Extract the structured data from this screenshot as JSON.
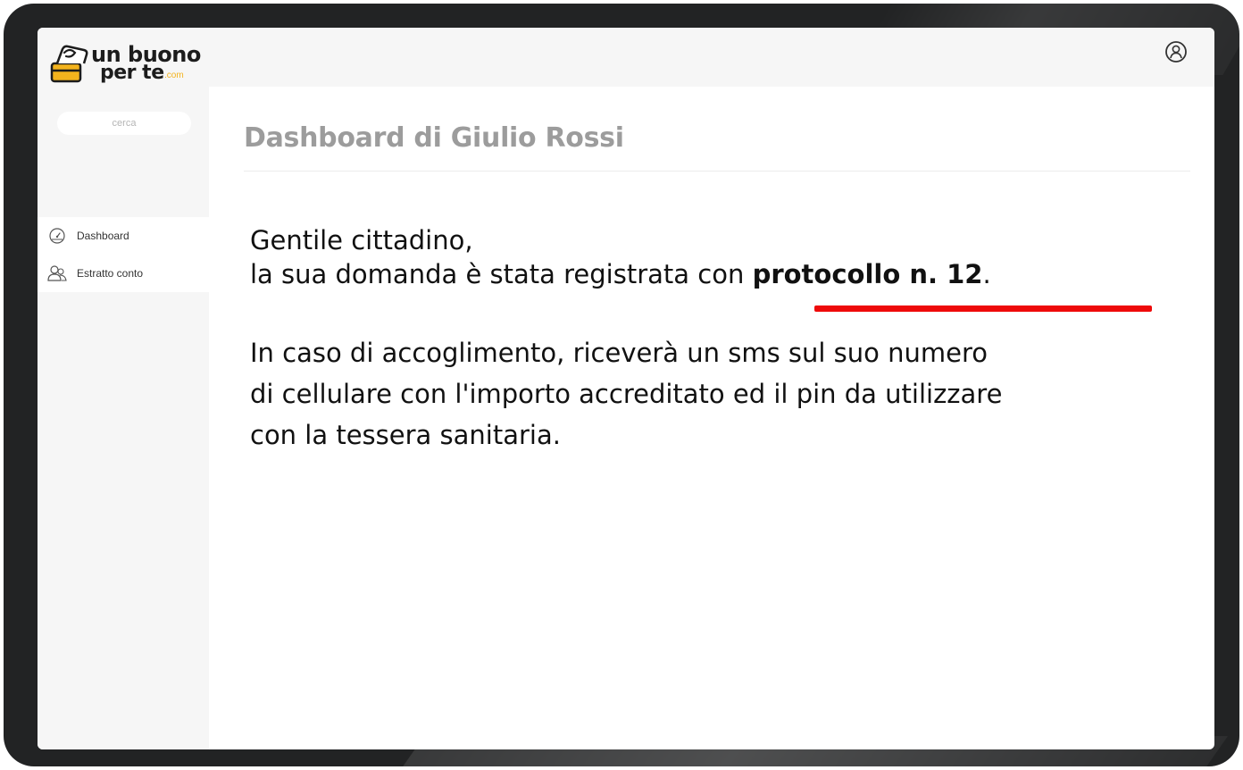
{
  "app": {
    "logo_line1": "un buono",
    "logo_line2": "per te",
    "logo_com": ".com"
  },
  "sidebar": {
    "search_placeholder": "cerca",
    "items": [
      {
        "label": "Dashboard",
        "icon": "gauge-icon"
      },
      {
        "label": "Estratto conto",
        "icon": "users-icon"
      }
    ]
  },
  "header": {
    "user_icon": "user-circle-icon"
  },
  "main": {
    "title": "Dashboard di Giulio Rossi",
    "greeting": "Gentile cittadino,",
    "registered_prefix": "la sua domanda è stata registrata con ",
    "protocol_label": "protocollo n. 12",
    "registered_suffix": ".",
    "info_line1": "In caso di accoglimento, riceverà un sms sul suo numero",
    "info_line2": "di cellulare con l'importo accreditato ed il pin da utilizzare",
    "info_line3": "con la tessera sanitaria."
  },
  "colors": {
    "highlight_underline": "#ee0a0a",
    "logo_accent": "#f3b31d",
    "title_gray": "#9c9c9c"
  }
}
